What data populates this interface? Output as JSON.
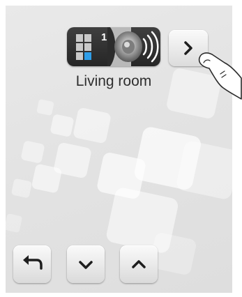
{
  "zone": {
    "number": "1",
    "name": "Living room",
    "grid_icon": "zone-grid-icon",
    "speaker_icon": "speaker-icon",
    "highlight_color": "#2f9ee8"
  },
  "navigation": {
    "next_icon": "chevron-right-icon"
  },
  "controls": {
    "back_icon": "back-arrow-icon",
    "down_icon": "chevron-down-icon",
    "up_icon": "chevron-up-icon"
  },
  "gesture": {
    "hand_icon": "pointing-finger-icon"
  }
}
